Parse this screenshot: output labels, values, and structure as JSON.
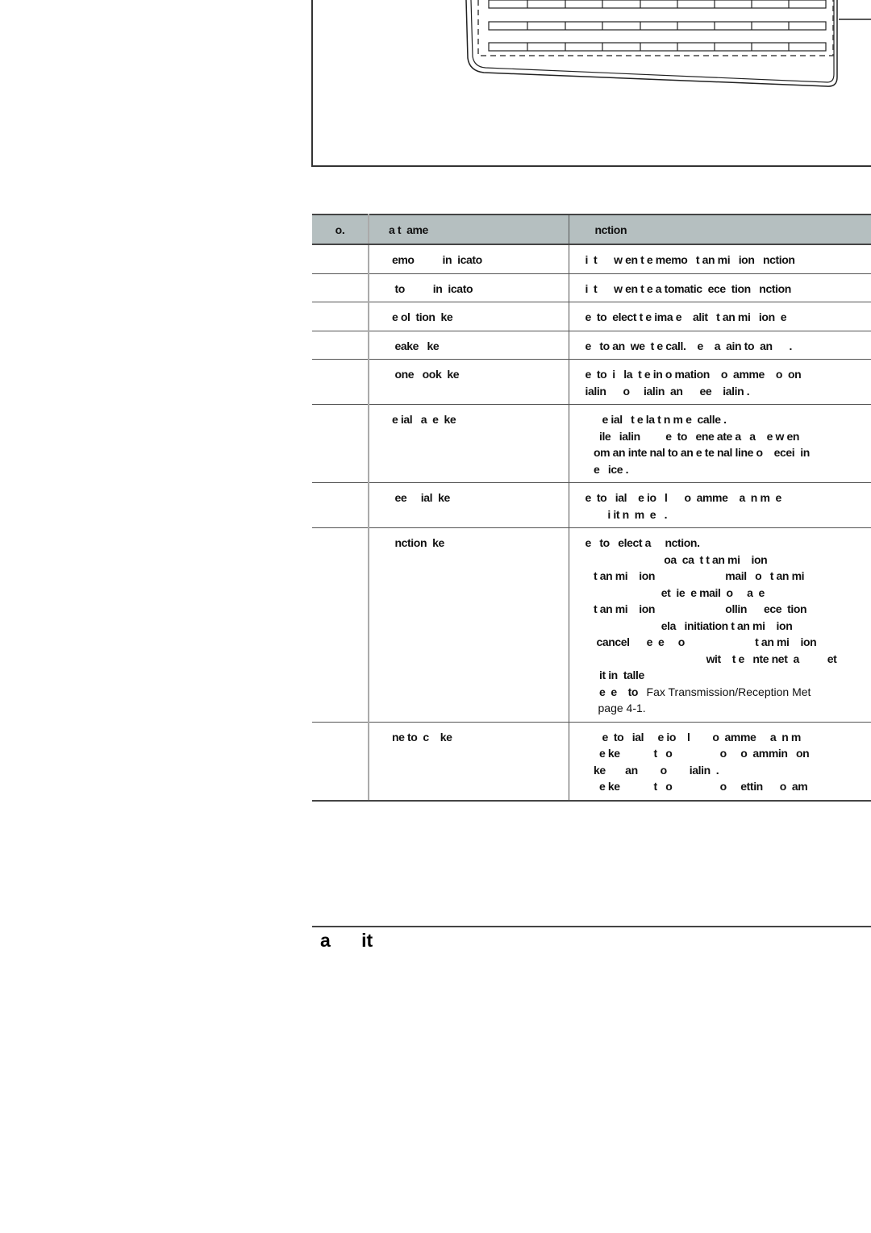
{
  "table": {
    "headers": [
      "o.",
      "a t  ame",
      "nction"
    ],
    "rows": [
      {
        "no": "",
        "key": "emo          in  icato",
        "func": [
          "i  t      w en t e memo   t an mi   ion   nction"
        ]
      },
      {
        "no": "",
        "key": " to          in  icato",
        "func": [
          "i  t      w en t e a tomatic  ece  tion   nction"
        ]
      },
      {
        "no": "",
        "key": "e ol  tion  ke",
        "func": [
          "e  to  elect t e ima e    alit   t an mi   ion  e"
        ]
      },
      {
        "no": "",
        "key": " eake   ke",
        "func": [
          "e   to an  we  t e call.    e    a  ain to  an      ."
        ]
      },
      {
        "no": "",
        "key": " one   ook  ke",
        "func": [
          "e  to  i   la  t e in o mation    o  amme    o  on",
          "ialin      o     ialin  an      ee    ialin ."
        ]
      },
      {
        "no": "",
        "key": "e ial   a  e  ke",
        "func": [
          "      e ial   t e la t n m e  calle .",
          "     ile   ialin         e  to   ene ate a   a    e w en",
          "   om an inte nal to an e te nal line o    ecei  in",
          "   e   ice ."
        ]
      },
      {
        "no": "",
        "key": " ee     ial  ke",
        "func": [
          "e  to   ial    e io   l      o  amme    a  n m  e",
          "        i it n  m  e   ."
        ]
      },
      {
        "no": "",
        "key": " nction  ke",
        "func": [
          "e   to   elect a     nction.",
          "                            oa  ca  t t an mi    ion",
          "   t an mi    ion                         mail   o   t an mi",
          "                           et  ie  e mail  o     a  e",
          "   t an mi    ion                         ollin      ece  tion",
          "                           ela   initiation t an mi    ion",
          "    cancel      e  e     o                         t an mi    ion",
          "                                           wit    t e   nte net  a          et",
          "     it in  talle",
          "     e  e    to   "
        ],
        "func_link": "Fax Transmission/Reception Met",
        "func_page": "page 4-1."
      },
      {
        "no": "",
        "key": "ne to  c    ke",
        "func": [
          "      e  to   ial     e io    l        o  amme     a  n m",
          "     e ke            t   o                 o     o  ammin   on",
          "   ke       an        o        ialin  .",
          "     e ke            t   o                 o     ettin      o  am"
        ]
      }
    ]
  },
  "footer": {
    "text": "a      it"
  }
}
